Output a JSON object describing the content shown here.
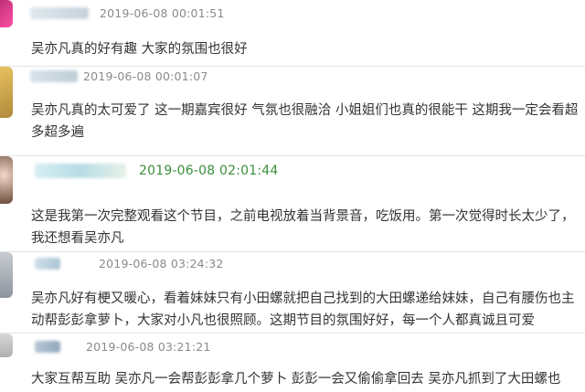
{
  "comments": [
    {
      "timestamp": "2019-06-08 00:01:51",
      "text": "吴亦凡真的好有趣 大家的氛围也很好",
      "avatar_colors": [
        "#c0307a",
        "#ff4fa3"
      ],
      "timestamp_color": "#8a8a8a"
    },
    {
      "timestamp": "2019-06-08 00:01:07",
      "text": "吴亦凡真的太可爱了 这一期嘉宾很好 气氛也很融洽 小姐姐们也真的很能干 这期我一定会看超多超多遍",
      "avatar_colors": [
        "#b08a3a",
        "#e8c060"
      ],
      "timestamp_color": "#8a8a8a"
    },
    {
      "timestamp": "2019-06-08 02:01:44",
      "text": "这是我第一次完整观看这个节目，之前电视放着当背景音，吃饭用。第一次觉得时长太少了，我还想看吴亦凡",
      "avatar_colors": [
        "#f3d7c8",
        "#6a4a3a"
      ],
      "timestamp_color": "#3b8f3b"
    },
    {
      "timestamp": "2019-06-08 03:24:32",
      "text": "吴亦凡好有梗又暖心，看着妹妹只有小田螺就把自己找到的大田螺递给妹妹，自己有腰伤也主动帮彭彭拿萝卜，大家对小凡也很照顾。这期节目的氛围好好，每一个人都真诚且可爱",
      "avatar_colors": [
        "#c8ccd2",
        "#8e959e"
      ],
      "timestamp_color": "#8a8a8a"
    },
    {
      "timestamp": "2019-06-08 03:21:21",
      "text": "大家互帮互助 吴亦凡一会帮彭彭拿几个萝卜 彭彭一会又偷偷拿回去 吴亦凡抓到了大田螺也",
      "avatar_colors": [
        "#d8d8d8",
        "#b0b0b0"
      ],
      "timestamp_color": "#8a8a8a"
    }
  ]
}
